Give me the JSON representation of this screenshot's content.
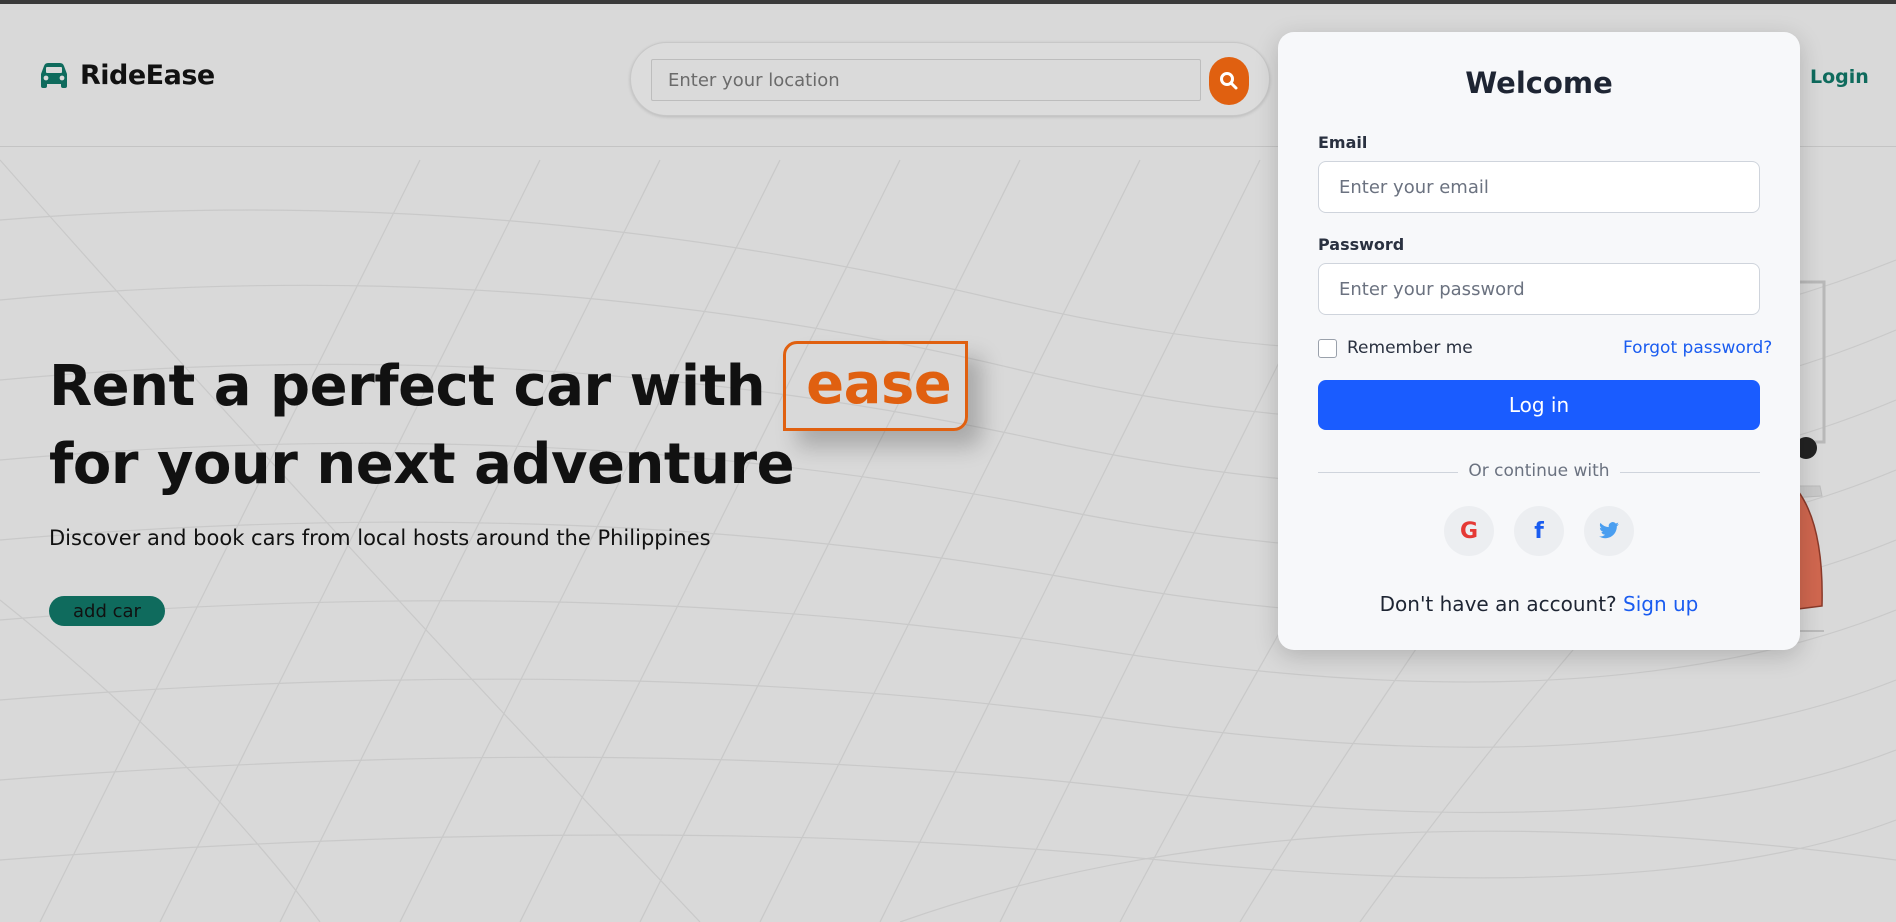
{
  "app": {
    "brand_name": "RideEase",
    "brand_icon": "car-icon",
    "accent_color": "#e06010",
    "brand_color": "#0f6b5d"
  },
  "header": {
    "search_placeholder": "Enter your location",
    "search_icon": "search-icon",
    "login_label": "Login"
  },
  "hero": {
    "headline_part1": "Rent a perfect car with",
    "headline_highlight": "ease",
    "headline_part2": "for your next adventure",
    "subtitle": "Discover and book cars from local hosts around the Philippines",
    "add_car_label": "add car"
  },
  "login_modal": {
    "title": "Welcome",
    "email_label": "Email",
    "email_placeholder": "Enter your email",
    "password_label": "Password",
    "password_placeholder": "Enter your password",
    "remember_label": "Remember me",
    "remember_checked": false,
    "forgot_label": "Forgot password?",
    "login_button": "Log in",
    "divider_text": "Or continue with",
    "social": [
      {
        "name": "google",
        "icon": "google-icon",
        "glyph": "G",
        "color": "#e53935"
      },
      {
        "name": "facebook",
        "icon": "facebook-icon",
        "glyph": "f",
        "color": "#1a5cf0"
      },
      {
        "name": "twitter",
        "icon": "twitter-icon",
        "glyph": "",
        "color": "#4a9ef0"
      }
    ],
    "signup_prompt": "Don't have an account?",
    "signup_link": "Sign up",
    "login_button_color": "#1a5cff"
  }
}
